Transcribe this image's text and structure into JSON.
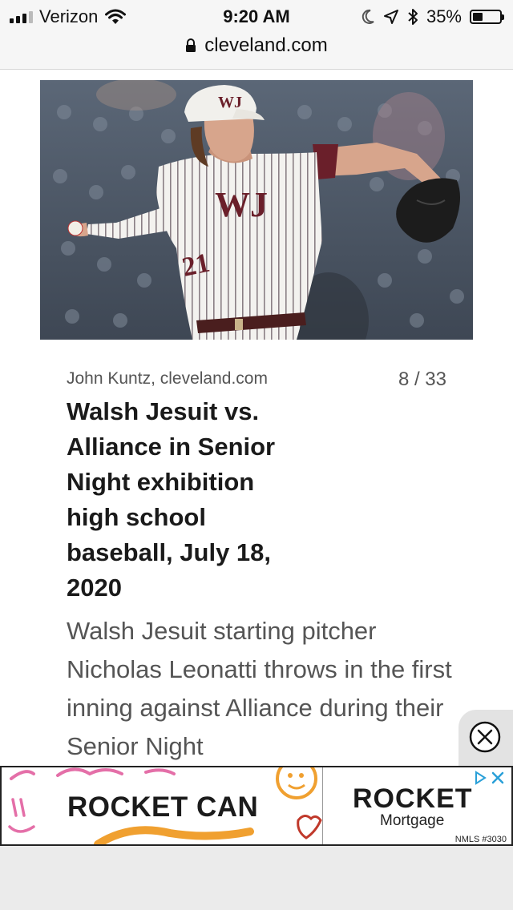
{
  "status_bar": {
    "carrier": "Verizon",
    "time": "9:20 AM",
    "battery_percent": "35%",
    "battery_level": 0.35,
    "signal_bars": 3
  },
  "browser": {
    "url": "cleveland.com",
    "lock_icon": "lock-icon"
  },
  "gallery": {
    "credit": "John Kuntz, cleveland.com",
    "counter": "8 / 33",
    "headline": "Walsh Jesuit vs. Alliance in Senior Night exhibition high school baseball, July 18, 2020",
    "description": "Walsh Jesuit starting pitcher Nicholas Leonatti throws in the first inning against Alliance during their Senior Night",
    "photo": {
      "cap_logo": "WJ",
      "jersey_logo": "WJ",
      "jersey_number": "21",
      "accent_color": "#6a1f2a"
    }
  },
  "ad": {
    "left_text": "ROCKET CAN",
    "right_brand": "ROCKET",
    "right_sub": "Mortgage",
    "nmls": "NMLS #3030",
    "close_icon": "close-circle-icon"
  }
}
